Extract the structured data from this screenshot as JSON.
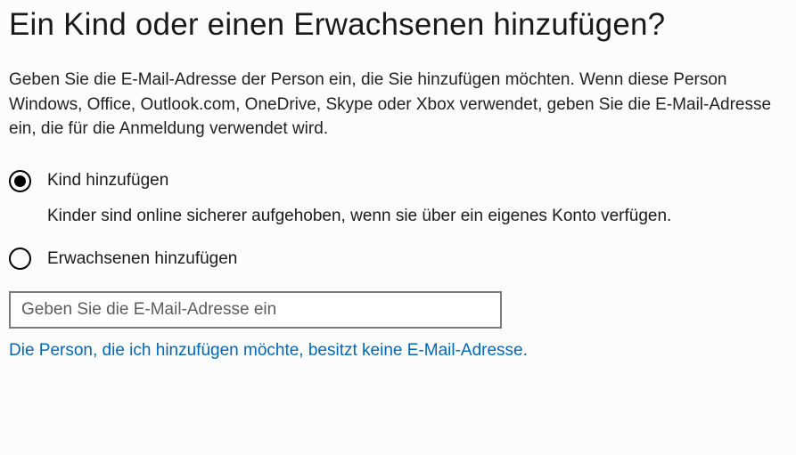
{
  "title": "Ein Kind oder einen Erwachsenen hinzufügen?",
  "description": "Geben Sie die E-Mail-Adresse der Person ein, die Sie hinzufügen möchten. Wenn diese Person Windows, Office, Outlook.com, OneDrive, Skype oder Xbox verwendet, geben Sie die E-Mail-Adresse ein, die für die Anmeldung verwendet wird.",
  "options": {
    "child": {
      "label": "Kind hinzufügen",
      "help": "Kinder sind online sicherer aufgehoben, wenn sie über ein eigenes Konto verfügen.",
      "selected": true
    },
    "adult": {
      "label": "Erwachsenen hinzufügen",
      "selected": false
    }
  },
  "email": {
    "placeholder": "Geben Sie die E-Mail-Adresse ein",
    "value": ""
  },
  "noEmailLink": "Die Person, die ich hinzufügen möchte, besitzt keine E-Mail-Adresse."
}
